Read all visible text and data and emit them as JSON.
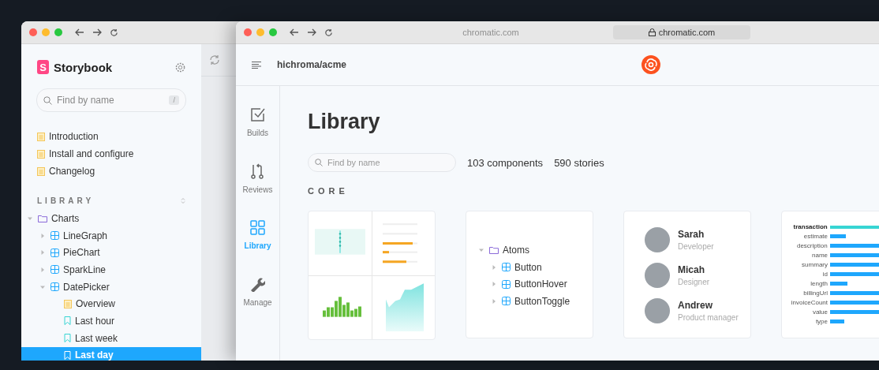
{
  "storybook_window": {
    "brand_mark": "S",
    "brand": "Storybook",
    "search": {
      "placeholder": "Find by name",
      "shortcut": "/"
    },
    "docs": [
      {
        "label": "Introduction"
      },
      {
        "label": "Install and configure"
      },
      {
        "label": "Changelog"
      }
    ],
    "section": "LIBRARY",
    "tree": [
      {
        "label": "Charts",
        "kind": "folder",
        "expanded": true,
        "selected": false,
        "children": [
          {
            "label": "LineGraph",
            "kind": "component",
            "expanded": false,
            "selected": false
          },
          {
            "label": "PieChart",
            "kind": "component",
            "expanded": false,
            "selected": false
          },
          {
            "label": "SparkLine",
            "kind": "component",
            "expanded": false,
            "selected": false
          },
          {
            "label": "DatePicker",
            "kind": "component",
            "expanded": true,
            "selected": false,
            "children": [
              {
                "label": "Overview",
                "kind": "doc",
                "selected": false
              },
              {
                "label": "Last hour",
                "kind": "story",
                "selected": false
              },
              {
                "label": "Last week",
                "kind": "story",
                "selected": false
              },
              {
                "label": "Last day",
                "kind": "story",
                "selected": true
              }
            ]
          }
        ]
      }
    ]
  },
  "chromatic_window": {
    "tab": "chromatic.com",
    "address": "chromatic.com",
    "project": "hichroma/acme",
    "nav": [
      {
        "label": "Builds",
        "kind": "builds",
        "selected": false
      },
      {
        "label": "Reviews",
        "kind": "reviews",
        "selected": false
      },
      {
        "label": "Library",
        "kind": "library",
        "selected": true
      },
      {
        "label": "Manage",
        "kind": "manage",
        "selected": false
      }
    ],
    "title": "Library",
    "search": {
      "placeholder": "Find by name"
    },
    "components": "103 components",
    "stories": "590 stories",
    "section": "CORE",
    "cards": [
      {
        "kind": "charts"
      },
      {
        "kind": "tree",
        "tree": [
          {
            "label": "Atoms",
            "kind": "folder",
            "expanded": true,
            "selected": false,
            "children": [
              {
                "label": "Button",
                "kind": "component",
                "expanded": false,
                "selected": false
              },
              {
                "label": "ButtonHover",
                "kind": "component",
                "expanded": false,
                "selected": false
              },
              {
                "label": "ButtonToggle",
                "kind": "component",
                "expanded": false,
                "selected": false
              }
            ]
          }
        ]
      },
      {
        "kind": "people",
        "people": [
          {
            "name": "Sarah",
            "role": "Developer"
          },
          {
            "name": "Micah",
            "role": "Designer"
          },
          {
            "name": "Andrew",
            "role": "Product manager"
          }
        ]
      },
      {
        "kind": "bars",
        "rows": [
          {
            "label": "transaction",
            "selected": true
          },
          {
            "label": "estimate",
            "selected": false
          },
          {
            "label": "description",
            "selected": false
          },
          {
            "label": "name",
            "selected": false
          },
          {
            "label": "summary",
            "selected": false
          },
          {
            "label": "id",
            "selected": false
          },
          {
            "label": "length",
            "selected": false
          },
          {
            "label": "billingUrl",
            "selected": false
          },
          {
            "label": "invoiceCount",
            "selected": false
          },
          {
            "label": "value",
            "selected": false
          },
          {
            "label": "type",
            "selected": false
          }
        ]
      }
    ]
  }
}
